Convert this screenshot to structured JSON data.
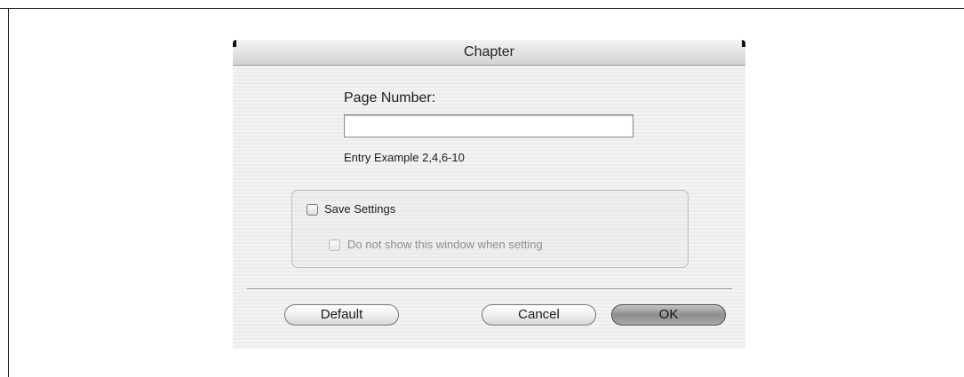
{
  "dialog": {
    "title": "Chapter",
    "page_number_label": "Page Number:",
    "page_number_value": "",
    "entry_example": "Entry Example 2,4,6-10",
    "save_settings_label": "Save Settings",
    "save_settings_checked": false,
    "do_not_show_label": "Do not show this window when setting",
    "do_not_show_checked": false,
    "do_not_show_enabled": false,
    "buttons": {
      "default_label": "Default",
      "cancel_label": "Cancel",
      "ok_label": "OK"
    }
  }
}
